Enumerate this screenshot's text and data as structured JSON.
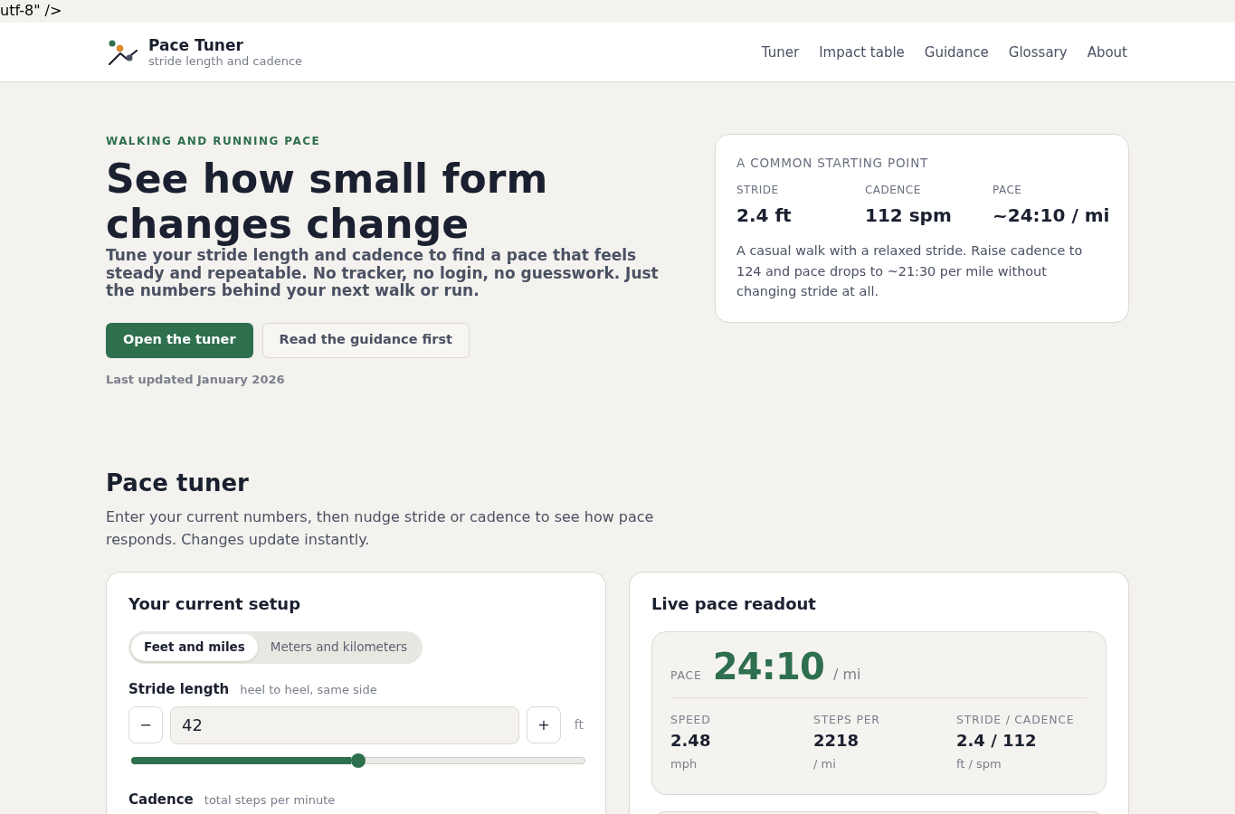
{
  "stray_text": "utf-8\" />",
  "header": {
    "brand": {
      "title": "Pace Tuner",
      "subtitle": "stride length and cadence"
    },
    "nav": [
      {
        "label": "Tuner"
      },
      {
        "label": "Impact table"
      },
      {
        "label": "Guidance"
      },
      {
        "label": "Glossary"
      },
      {
        "label": "About"
      }
    ]
  },
  "hero": {
    "eyebrow": "WALKING AND RUNNING PACE",
    "title": "See how small form changes change",
    "lead": "Tune your stride length and cadence to find a pace that feels steady and repeatable. No tracker, no login, no guesswork. Just the numbers behind your next walk or run.",
    "buttons": [
      {
        "label": "Open the tuner",
        "kind": "primary"
      },
      {
        "label": "Read the guidance first",
        "kind": "secondary"
      }
    ],
    "updated": "Last updated January 2026"
  },
  "starting_point": {
    "title": "A COMMON STARTING POINT",
    "stats": [
      {
        "label": "STRIDE",
        "value": "2.4 ft"
      },
      {
        "label": "CADENCE",
        "value": "112 spm"
      },
      {
        "label": "PACE",
        "value": "~24:10 / mi"
      }
    ],
    "note": "A casual walk with a relaxed stride. Raise cadence to 124 and pace drops to ~21:30 per mile without changing stride at all."
  },
  "tuner": {
    "title": "Pace tuner",
    "intro": "Enter your current numbers, then nudge stride or cadence to see how pace responds. Changes update instantly.",
    "setup": {
      "title": "Your current setup",
      "units": [
        {
          "label": "Feet and miles",
          "selected": true
        },
        {
          "label": "Meters and kilometers",
          "selected": false
        }
      ],
      "fields": [
        {
          "label": "Stride length",
          "hint": "heel to heel, same side",
          "value": "42",
          "decrement": "−",
          "increment": "+",
          "unit": "ft",
          "level": 0.5
        },
        {
          "label": "Cadence",
          "hint": "total steps per minute"
        }
      ]
    },
    "readout": {
      "title": "Live pace readout",
      "pace": {
        "label": "PACE",
        "value": "24:10",
        "unit": "/ mi"
      },
      "stats": [
        {
          "label": "SPEED",
          "value": "2.48",
          "unit": "mph"
        },
        {
          "label": "STEPS PER",
          "value": "2218",
          "unit": "/ mi"
        },
        {
          "label": "STRIDE / CADENCE",
          "value": "2.4 / 112",
          "unit": "ft / spm"
        }
      ]
    }
  }
}
